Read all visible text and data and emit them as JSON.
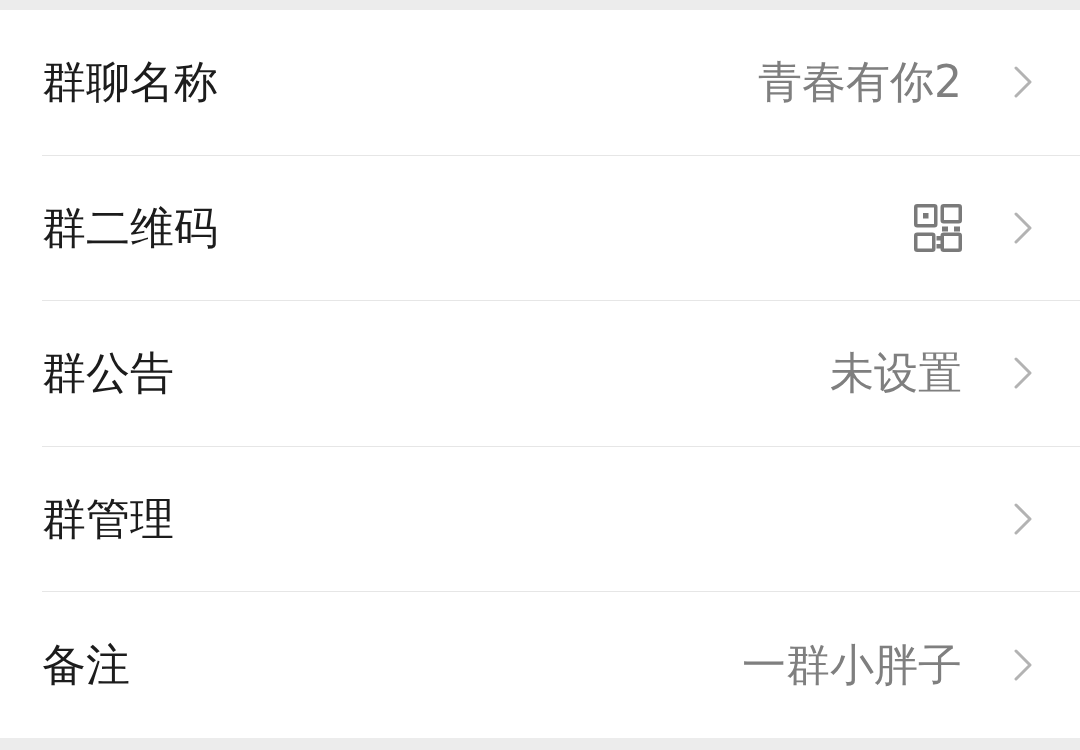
{
  "settings": [
    {
      "label": "群聊名称",
      "kind": "text",
      "value": "青春有你2"
    },
    {
      "label": "群二维码",
      "kind": "qr_code"
    },
    {
      "label": "群公告",
      "kind": "text",
      "value": "未设置"
    },
    {
      "label": "群管理",
      "kind": "plain"
    },
    {
      "label": "备注",
      "kind": "text",
      "value": "一群小胖子"
    }
  ]
}
